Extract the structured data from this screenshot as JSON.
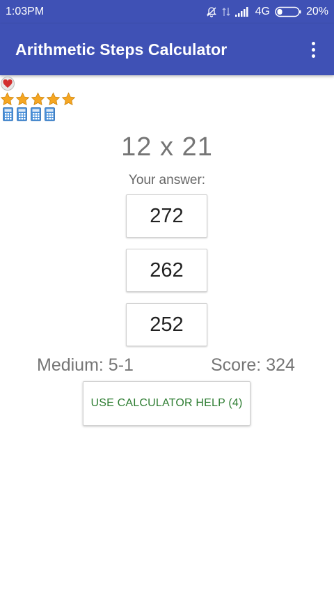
{
  "status_bar": {
    "time": "1:03PM",
    "network": "4G",
    "battery": "20%"
  },
  "app_bar": {
    "title": "Arithmetic Steps Calculator",
    "menu_icon": "overflow-menu-icon"
  },
  "rating": {
    "heart_icon": "heart-icon",
    "stars": 5,
    "calculators": 4
  },
  "question": "12 x 21",
  "answer_label": "Your answer:",
  "options": [
    "272",
    "262",
    "252"
  ],
  "difficulty": "Medium: 5-1",
  "score": "Score: 324",
  "help_button": "USE CALCULATOR HELP (4)",
  "colors": {
    "primary": "#3f51b5",
    "help_text": "#2e7d32",
    "star": "#f5a623",
    "calculator": "#4a90d9",
    "heart": "#d32f2f"
  }
}
